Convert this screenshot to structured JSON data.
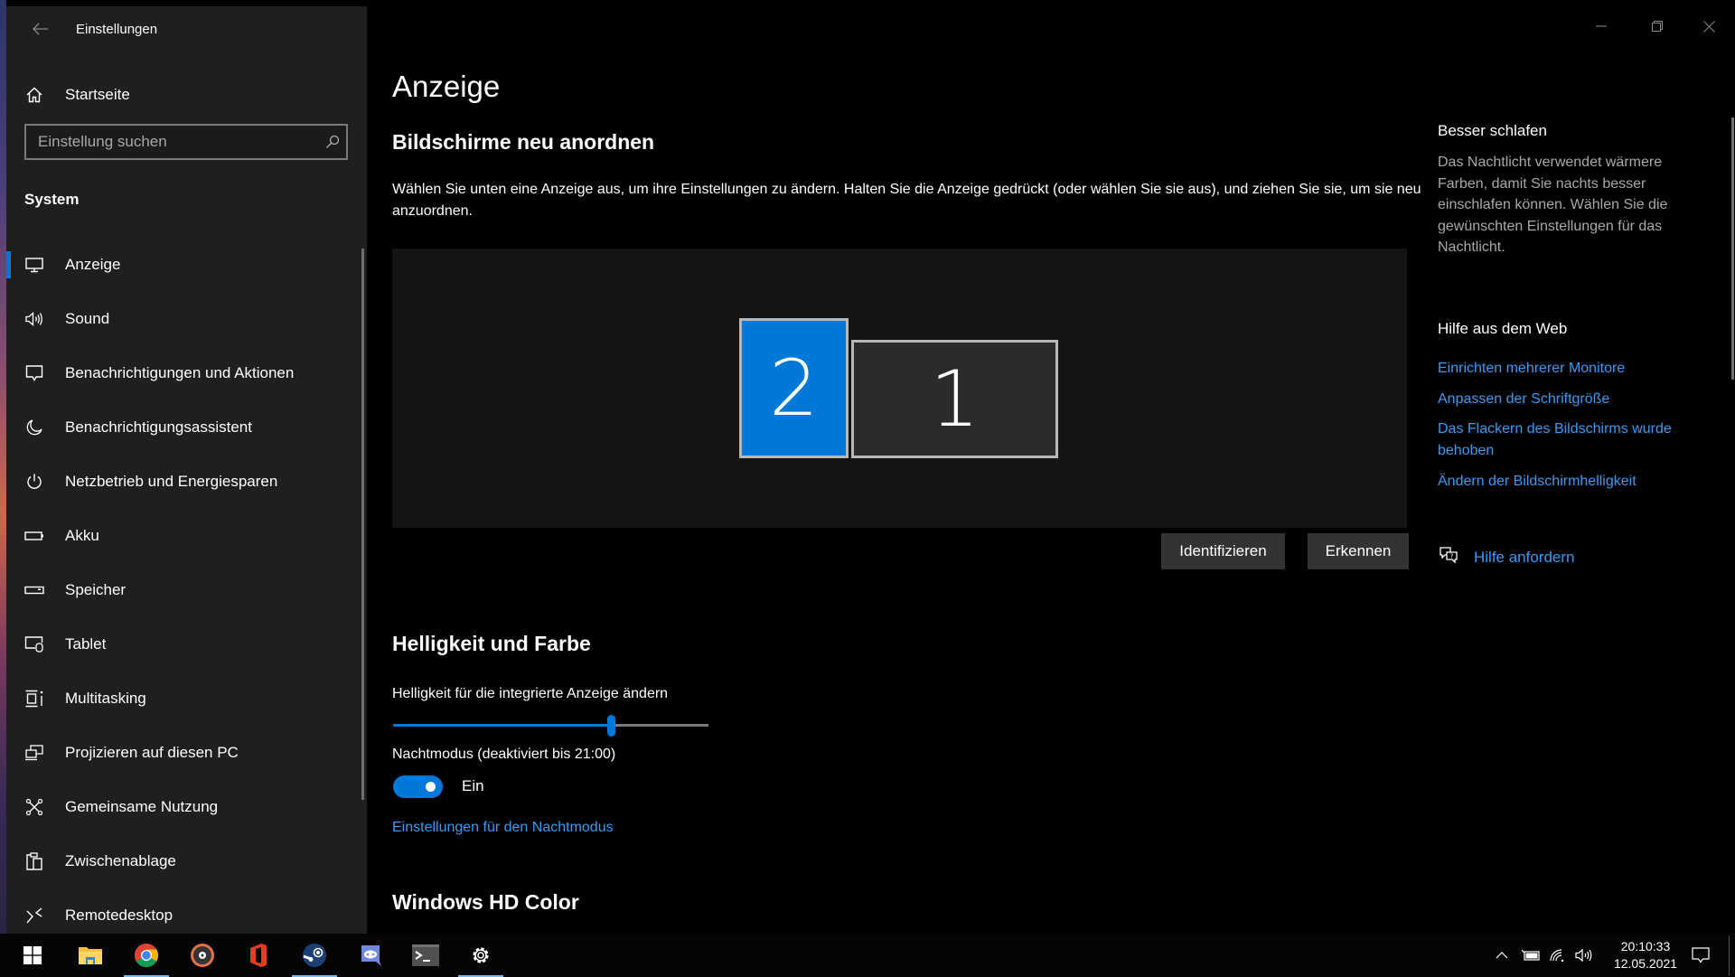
{
  "window": {
    "title": "Einstellungen",
    "controls": {
      "minimize": "minimize",
      "maximize": "restore",
      "close": "close"
    }
  },
  "sidebar": {
    "home_label": "Startseite",
    "search": {
      "placeholder": "Einstellung suchen",
      "value": ""
    },
    "section": "System",
    "items": [
      {
        "label": "Anzeige",
        "icon": "monitor-icon",
        "active": true
      },
      {
        "label": "Sound",
        "icon": "speaker-icon"
      },
      {
        "label": "Benachrichtigungen und Aktionen",
        "icon": "notification-icon"
      },
      {
        "label": "Benachrichtigungsassistent",
        "icon": "moon-icon"
      },
      {
        "label": "Netzbetrieb und Energiesparen",
        "icon": "power-icon"
      },
      {
        "label": "Akku",
        "icon": "battery-icon"
      },
      {
        "label": "Speicher",
        "icon": "storage-icon"
      },
      {
        "label": "Tablet",
        "icon": "tablet-icon"
      },
      {
        "label": "Multitasking",
        "icon": "multitasking-icon"
      },
      {
        "label": "Projizieren auf diesen PC",
        "icon": "project-icon"
      },
      {
        "label": "Gemeinsame Nutzung",
        "icon": "share-icon"
      },
      {
        "label": "Zwischenablage",
        "icon": "clipboard-icon"
      },
      {
        "label": "Remotedesktop",
        "icon": "remote-desktop-icon"
      }
    ]
  },
  "main": {
    "title": "Anzeige",
    "arrange": {
      "heading": "Bildschirme neu anordnen",
      "description": "Wählen Sie unten eine Anzeige aus, um ihre Einstellungen zu ändern. Halten Sie die Anzeige gedrückt (oder wählen Sie sie aus), und ziehen Sie sie, um sie neu anzuordnen.",
      "monitors": [
        {
          "number": "2",
          "selected": true
        },
        {
          "number": "1",
          "selected": false
        }
      ],
      "identify_button": "Identifizieren",
      "detect_button": "Erkennen"
    },
    "brightness": {
      "heading": "Helligkeit und Farbe",
      "slider_label": "Helligkeit für die integrierte Anzeige ändern",
      "slider_value_percent": 69,
      "night_mode_label": "Nachtmodus (deaktiviert bis 21:00)",
      "night_mode_state": "Ein",
      "night_mode_on": true,
      "night_mode_settings_link": "Einstellungen für den Nachtmodus"
    },
    "hd_color_heading": "Windows HD Color"
  },
  "right_panel": {
    "sleep_heading": "Besser schlafen",
    "sleep_text": "Das Nachtlicht verwendet wärmere Farben, damit Sie nachts besser einschlafen können. Wählen Sie die gewünschten Einstellungen für das Nachtlicht.",
    "web_help_heading": "Hilfe aus dem Web",
    "links": [
      "Einrichten mehrerer Monitore",
      "Anpassen der Schriftgröße",
      "Das Flackern des Bildschirms wurde behoben",
      "Ändern der Bildschirmhelligkeit"
    ],
    "get_help": "Hilfe anfordern"
  },
  "taskbar": {
    "apps": [
      {
        "name": "start",
        "running": false
      },
      {
        "name": "file-explorer",
        "running": false
      },
      {
        "name": "chrome",
        "running": true
      },
      {
        "name": "groove-music",
        "running": false
      },
      {
        "name": "office",
        "running": false
      },
      {
        "name": "steam",
        "running": true
      },
      {
        "name": "discord",
        "running": false
      },
      {
        "name": "terminal",
        "running": false
      },
      {
        "name": "settings",
        "running": true
      }
    ],
    "time": "20:10:33",
    "date": "12.05.2021"
  },
  "colors": {
    "accent": "#0078d7",
    "link": "#3a9bf0",
    "sidebar_bg": "#1f1f1f",
    "main_bg": "#000000"
  }
}
